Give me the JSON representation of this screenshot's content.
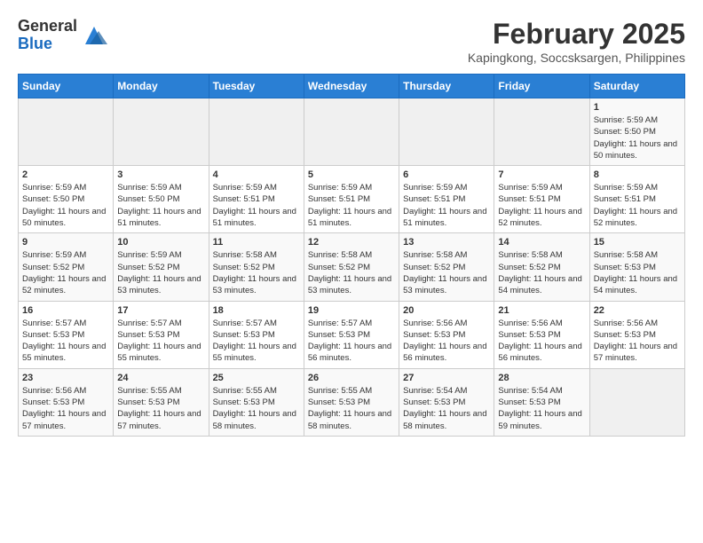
{
  "header": {
    "logo_general": "General",
    "logo_blue": "Blue",
    "month_year": "February 2025",
    "location": "Kapingkong, Soccsksargen, Philippines"
  },
  "weekdays": [
    "Sunday",
    "Monday",
    "Tuesday",
    "Wednesday",
    "Thursday",
    "Friday",
    "Saturday"
  ],
  "weeks": [
    {
      "days": [
        {
          "num": "",
          "info": ""
        },
        {
          "num": "",
          "info": ""
        },
        {
          "num": "",
          "info": ""
        },
        {
          "num": "",
          "info": ""
        },
        {
          "num": "",
          "info": ""
        },
        {
          "num": "",
          "info": ""
        },
        {
          "num": "1",
          "info": "Sunrise: 5:59 AM\nSunset: 5:50 PM\nDaylight: 11 hours and 50 minutes."
        }
      ]
    },
    {
      "days": [
        {
          "num": "2",
          "info": "Sunrise: 5:59 AM\nSunset: 5:50 PM\nDaylight: 11 hours and 50 minutes."
        },
        {
          "num": "3",
          "info": "Sunrise: 5:59 AM\nSunset: 5:50 PM\nDaylight: 11 hours and 51 minutes."
        },
        {
          "num": "4",
          "info": "Sunrise: 5:59 AM\nSunset: 5:51 PM\nDaylight: 11 hours and 51 minutes."
        },
        {
          "num": "5",
          "info": "Sunrise: 5:59 AM\nSunset: 5:51 PM\nDaylight: 11 hours and 51 minutes."
        },
        {
          "num": "6",
          "info": "Sunrise: 5:59 AM\nSunset: 5:51 PM\nDaylight: 11 hours and 51 minutes."
        },
        {
          "num": "7",
          "info": "Sunrise: 5:59 AM\nSunset: 5:51 PM\nDaylight: 11 hours and 52 minutes."
        },
        {
          "num": "8",
          "info": "Sunrise: 5:59 AM\nSunset: 5:51 PM\nDaylight: 11 hours and 52 minutes."
        }
      ]
    },
    {
      "days": [
        {
          "num": "9",
          "info": "Sunrise: 5:59 AM\nSunset: 5:52 PM\nDaylight: 11 hours and 52 minutes."
        },
        {
          "num": "10",
          "info": "Sunrise: 5:59 AM\nSunset: 5:52 PM\nDaylight: 11 hours and 53 minutes."
        },
        {
          "num": "11",
          "info": "Sunrise: 5:58 AM\nSunset: 5:52 PM\nDaylight: 11 hours and 53 minutes."
        },
        {
          "num": "12",
          "info": "Sunrise: 5:58 AM\nSunset: 5:52 PM\nDaylight: 11 hours and 53 minutes."
        },
        {
          "num": "13",
          "info": "Sunrise: 5:58 AM\nSunset: 5:52 PM\nDaylight: 11 hours and 53 minutes."
        },
        {
          "num": "14",
          "info": "Sunrise: 5:58 AM\nSunset: 5:52 PM\nDaylight: 11 hours and 54 minutes."
        },
        {
          "num": "15",
          "info": "Sunrise: 5:58 AM\nSunset: 5:53 PM\nDaylight: 11 hours and 54 minutes."
        }
      ]
    },
    {
      "days": [
        {
          "num": "16",
          "info": "Sunrise: 5:57 AM\nSunset: 5:53 PM\nDaylight: 11 hours and 55 minutes."
        },
        {
          "num": "17",
          "info": "Sunrise: 5:57 AM\nSunset: 5:53 PM\nDaylight: 11 hours and 55 minutes."
        },
        {
          "num": "18",
          "info": "Sunrise: 5:57 AM\nSunset: 5:53 PM\nDaylight: 11 hours and 55 minutes."
        },
        {
          "num": "19",
          "info": "Sunrise: 5:57 AM\nSunset: 5:53 PM\nDaylight: 11 hours and 56 minutes."
        },
        {
          "num": "20",
          "info": "Sunrise: 5:56 AM\nSunset: 5:53 PM\nDaylight: 11 hours and 56 minutes."
        },
        {
          "num": "21",
          "info": "Sunrise: 5:56 AM\nSunset: 5:53 PM\nDaylight: 11 hours and 56 minutes."
        },
        {
          "num": "22",
          "info": "Sunrise: 5:56 AM\nSunset: 5:53 PM\nDaylight: 11 hours and 57 minutes."
        }
      ]
    },
    {
      "days": [
        {
          "num": "23",
          "info": "Sunrise: 5:56 AM\nSunset: 5:53 PM\nDaylight: 11 hours and 57 minutes."
        },
        {
          "num": "24",
          "info": "Sunrise: 5:55 AM\nSunset: 5:53 PM\nDaylight: 11 hours and 57 minutes."
        },
        {
          "num": "25",
          "info": "Sunrise: 5:55 AM\nSunset: 5:53 PM\nDaylight: 11 hours and 58 minutes."
        },
        {
          "num": "26",
          "info": "Sunrise: 5:55 AM\nSunset: 5:53 PM\nDaylight: 11 hours and 58 minutes."
        },
        {
          "num": "27",
          "info": "Sunrise: 5:54 AM\nSunset: 5:53 PM\nDaylight: 11 hours and 58 minutes."
        },
        {
          "num": "28",
          "info": "Sunrise: 5:54 AM\nSunset: 5:53 PM\nDaylight: 11 hours and 59 minutes."
        },
        {
          "num": "",
          "info": ""
        }
      ]
    }
  ]
}
